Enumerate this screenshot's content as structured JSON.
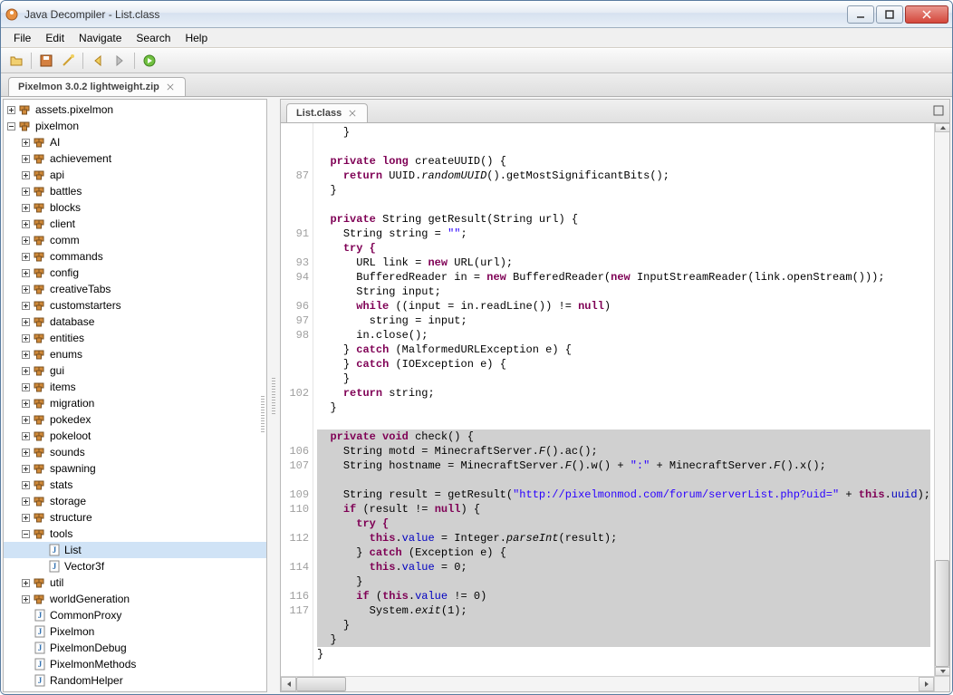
{
  "window": {
    "title": "Java Decompiler - List.class"
  },
  "menu": {
    "file": "File",
    "edit": "Edit",
    "navigate": "Navigate",
    "search": "Search",
    "help": "Help"
  },
  "project_tab": "Pixelmon 3.0.2 lightweight.zip",
  "tree": {
    "root1": "assets.pixelmon",
    "root2": "pixelmon",
    "children": [
      "AI",
      "achievement",
      "api",
      "battles",
      "blocks",
      "client",
      "comm",
      "commands",
      "config",
      "creativeTabs",
      "customstarters",
      "database",
      "entities",
      "enums",
      "gui",
      "items",
      "migration",
      "pokedex",
      "pokeloot",
      "sounds",
      "spawning",
      "stats",
      "storage",
      "structure"
    ],
    "tools": "tools",
    "tools_children": [
      "List",
      "Vector3f"
    ],
    "util": "util",
    "worldGeneration": "worldGeneration",
    "classes_after": [
      "CommonProxy",
      "Pixelmon",
      "PixelmonDebug",
      "PixelmonMethods",
      "RandomHelper"
    ]
  },
  "editor_tab": "List.class",
  "gutter": {
    "87": "87",
    "91": "91",
    "93": "93",
    "94": "94",
    "96": "96",
    "97": "97",
    "98": "98",
    "102": "102",
    "106": "106",
    "107": "107",
    "109": "109",
    "110": "110",
    "112": "112",
    "114": "114",
    "116": "116",
    "117": "117"
  },
  "code": {
    "c1": "    }",
    "c2": "  ",
    "c3a": "  private long ",
    "c3b": "createUUID",
    "c3c": "() {",
    "c4a": "    return ",
    "c4b": "UUID",
    "c4c": ".",
    "c4d": "randomUUID",
    "c4e": "().getMostSignificantBits();",
    "c5": "  }",
    "c6": "  ",
    "c7a": "  private ",
    "c7b": "String ",
    "c7c": "getResult",
    "c7d": "(String url) {",
    "c8a": "    String string = ",
    "c8b": "\"\"",
    "c8c": ";",
    "c9a": "    try {",
    "c10a": "      URL link = ",
    "c10b": "new ",
    "c10c": "URL(url);",
    "c11a": "      BufferedReader in = ",
    "c11b": "new ",
    "c11c": "BufferedReader(",
    "c11d": "new ",
    "c11e": "InputStreamReader(link.openStream()));",
    "c12": "      String input;",
    "c13a": "      while ",
    "c13b": "((input = in.readLine()) != ",
    "c13c": "null",
    "c13d": ")",
    "c14": "        string = input;",
    "c15": "      in.close();",
    "c16a": "    } ",
    "c16b": "catch ",
    "c16c": "(MalformedURLException e) {",
    "c17a": "    } ",
    "c17b": "catch ",
    "c17c": "(IOException e) {",
    "c18": "    }",
    "c19a": "    return ",
    "c19b": "string;",
    "c20": "  }",
    "c21": "  ",
    "c22a": "  private void ",
    "c22b": "check",
    "c22c": "() {",
    "c23a": "    String motd = MinecraftServer.",
    "c23b": "F",
    "c23c": "().ac();",
    "c24a": "    String hostname = MinecraftServer.",
    "c24b": "F",
    "c24c": "().w() + ",
    "c24d": "\":\"",
    "c24e": " + MinecraftServer.",
    "c24f": "F",
    "c24g": "().x();",
    "c25": "    ",
    "c26a": "    String result = getResult(",
    "c26b": "\"http://pixelmonmod.com/forum/serverList.php?uid=\"",
    "c26c": " + ",
    "c26d": "this",
    "c26e": ".",
    "c26f": "uuid",
    "c26g": ");",
    "c27a": "    if ",
    "c27b": "(result != ",
    "c27c": "null",
    "c27d": ") {",
    "c28a": "      try {",
    "c29a": "        this",
    "c29b": ".",
    "c29c": "value",
    "c29d": " = Integer.",
    "c29e": "parseInt",
    "c29f": "(result);",
    "c30a": "      } ",
    "c30b": "catch ",
    "c30c": "(Exception e) {",
    "c31a": "        this",
    "c31b": ".",
    "c31c": "value",
    "c31d": " = 0;",
    "c32": "      }",
    "c33a": "      if ",
    "c33b": "(",
    "c33c": "this",
    "c33d": ".",
    "c33e": "value",
    "c33f": " != 0)",
    "c34a": "        System.",
    "c34b": "exit",
    "c34c": "(1);",
    "c35": "    }",
    "c36": "  }",
    "c37": "}"
  }
}
